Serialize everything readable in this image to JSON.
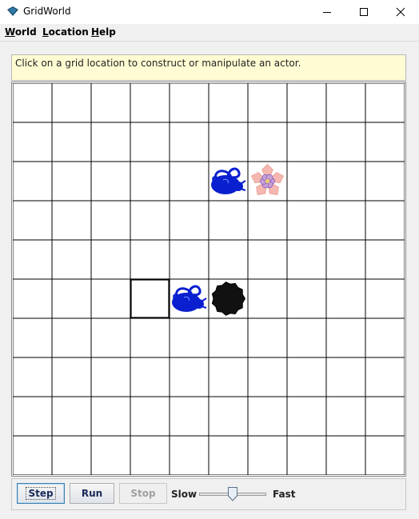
{
  "window": {
    "title": "GridWorld",
    "controls": [
      "minimize-icon",
      "maximize-icon",
      "close-icon"
    ]
  },
  "menu": {
    "items": [
      {
        "label": "World"
      },
      {
        "label": "Location"
      },
      {
        "label": "Help"
      }
    ]
  },
  "message": "Click on a grid location to construct or manipulate an actor.",
  "grid": {
    "rows": 10,
    "cols": 10,
    "selected": {
      "row": 5,
      "col": 3
    },
    "actors": [
      {
        "type": "bug",
        "row": 2,
        "col": 5,
        "direction": "right",
        "color": "#0a1fd0"
      },
      {
        "type": "flower",
        "row": 2,
        "col": 6,
        "color": "#c8a0d8"
      },
      {
        "type": "bug",
        "row": 5,
        "col": 4,
        "direction": "right",
        "color": "#0a1fd0"
      },
      {
        "type": "rock",
        "row": 5,
        "col": 5,
        "color": "#111111"
      }
    ]
  },
  "controls": {
    "step_label": "Step",
    "run_label": "Run",
    "stop_label": "Stop",
    "stop_enabled": false,
    "slow_label": "Slow",
    "fast_label": "Fast",
    "speed_fraction": 0.5
  }
}
